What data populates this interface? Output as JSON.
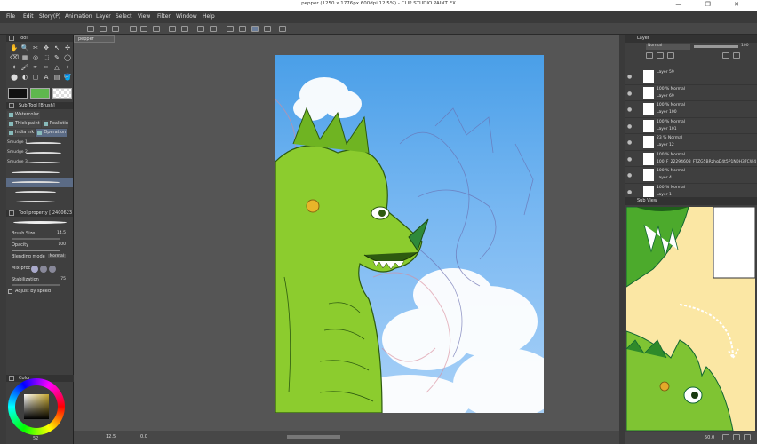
{
  "window": {
    "title": "pepper (1250 x 1776px 600dpi 12.5%) - CLIP STUDIO PAINT EX",
    "controls": "— ❐ ✕"
  },
  "menu": [
    "File",
    "Edit",
    "Story(P)",
    "Animation",
    "Layer",
    "Select",
    "View",
    "Filter",
    "Window",
    "Help"
  ],
  "document_tab": "pepper",
  "tool_panel": {
    "title": "Tool",
    "tools": [
      "✋",
      "🔍",
      "✂",
      "✥",
      "↖",
      "✣",
      "⌫",
      "▦",
      "◎",
      "⬚",
      "✎",
      "◯",
      "✦",
      "🖌",
      "✒",
      "✏",
      "△",
      "✧",
      "⬤",
      "◐",
      "▢",
      "A",
      "▤",
      "🪣"
    ]
  },
  "colors": {
    "main": "#111111",
    "sub": "#5fb84e",
    "transparent_label": "transparent"
  },
  "subtool_panel": {
    "title": "Sub Tool [Brush]",
    "tabs": [
      "Watercolor",
      "Thick paint",
      "Realistic",
      "India ink",
      "Operation"
    ],
    "brushes": [
      "Smudge 1",
      "Smudge 2",
      "Smudge 3",
      "",
      "",
      "",
      ""
    ]
  },
  "tool_property": {
    "title": "Tool property [ 2400623 ]",
    "brush_size_label": "Brush Size",
    "brush_size_value": "14.5",
    "opacity_label": "Opacity",
    "opacity_value": "100",
    "blending_label": "Blending mode",
    "blending_value": "Normal",
    "mixing_label": "Mix-proc",
    "stabilization_label": "Stabilization",
    "stabilization_value": "75",
    "adjust_label": "Adjust by speed"
  },
  "color_panel": {
    "title": "Color",
    "bottom_readout": "52"
  },
  "status": {
    "zoom": "12.5",
    "angle": "0.0"
  },
  "layer_panel": {
    "title": "Layer",
    "blend_mode": "Normal",
    "opacity": "100",
    "layers": [
      {
        "blend": "Layer 59",
        "name": ""
      },
      {
        "blend": "100 % Normal",
        "name": "Layer 69"
      },
      {
        "blend": "100 % Normal",
        "name": "Layer 100"
      },
      {
        "blend": "100 % Normal",
        "name": "Layer 101"
      },
      {
        "blend": "23 % Normal",
        "name": "Layer 12"
      },
      {
        "blend": "100 % Normal",
        "name": "100_F_22294608_FTZG5BRzhgD4t5P1N0H37CW4"
      },
      {
        "blend": "100 % Normal",
        "name": "Layer 4"
      },
      {
        "blend": "100 % Normal",
        "name": "Layer 1"
      }
    ]
  },
  "subview": {
    "title": "Sub View",
    "zoom": "50.0"
  }
}
